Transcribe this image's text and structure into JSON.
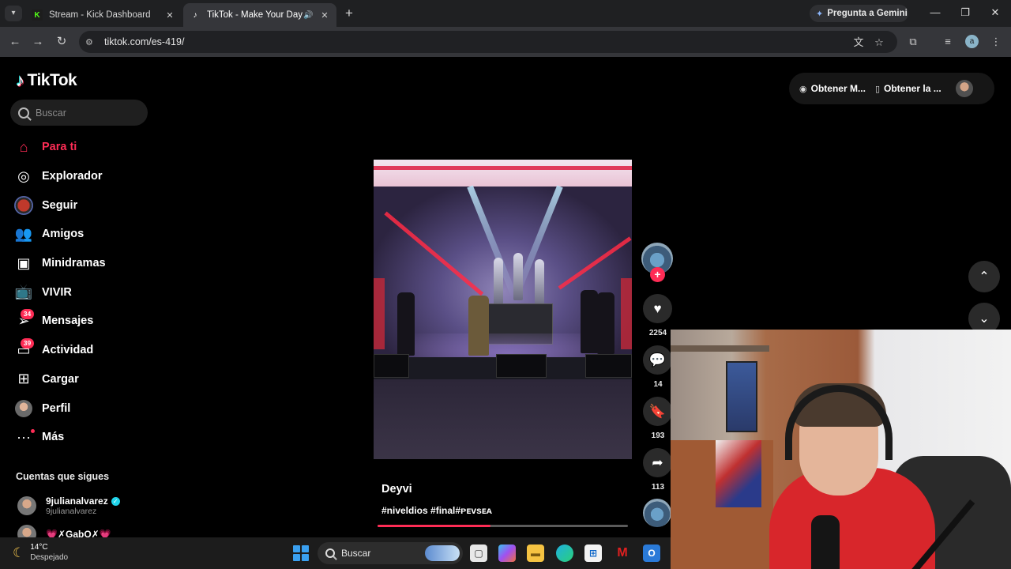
{
  "browser": {
    "tabs": [
      {
        "title": "Stream - Kick Dashboard",
        "favicon": "kick-icon"
      },
      {
        "title": "TikTok - Make Your Day",
        "favicon": "tiktok-icon"
      }
    ],
    "gemini_label": "Pregunta a Gemini",
    "url": "tiktok.com/es-419/",
    "profile_initial": "a"
  },
  "tiktok": {
    "logo_text": "TikTok",
    "search_placeholder": "Buscar",
    "nav": [
      {
        "label": "Para ti",
        "icon": "home-icon"
      },
      {
        "label": "Explorador",
        "icon": "compass-icon"
      },
      {
        "label": "Seguir",
        "icon": "following-avatar-icon"
      },
      {
        "label": "Amigos",
        "icon": "friends-icon"
      },
      {
        "label": "Minidramas",
        "icon": "minidramas-icon"
      },
      {
        "label": "VIVIR",
        "icon": "live-icon"
      },
      {
        "label": "Mensajes",
        "icon": "messages-icon",
        "badge": "34"
      },
      {
        "label": "Actividad",
        "icon": "activity-icon",
        "badge": "39"
      },
      {
        "label": "Cargar",
        "icon": "upload-icon"
      },
      {
        "label": "Perfil",
        "icon": "profile-avatar-icon"
      },
      {
        "label": "Más",
        "icon": "more-icon"
      }
    ],
    "following_title": "Cuentas que sigues",
    "following": [
      {
        "name": "9julianalvarez",
        "handle": "9julianalvarez",
        "verified": true
      },
      {
        "name": "💗✗GabO✗💗",
        "handle": ""
      }
    ],
    "top_right": {
      "get_coins": "Obtener M...",
      "get_app": "Obtener la ..."
    },
    "video": {
      "author": "Deyvi",
      "tags": "#niveldios #final#ᴘᴇᴠsᴇᴀ",
      "progress": 0.45
    },
    "actions": {
      "likes": "2254",
      "comments": "14",
      "saves": "193",
      "shares": "113"
    }
  },
  "taskbar": {
    "temperature": "14°C",
    "weather": "Despejado",
    "search_placeholder": "Buscar"
  },
  "colors": {
    "accent": "#fe2c55",
    "background": "#000000",
    "chrome_dark": "#1f2022",
    "chrome_toolbar": "#35363a"
  }
}
